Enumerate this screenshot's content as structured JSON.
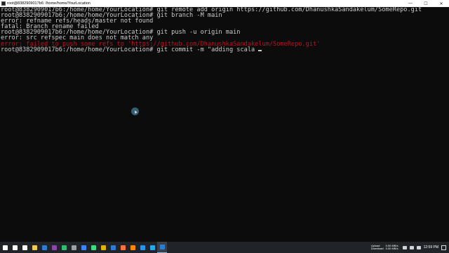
{
  "window": {
    "title": "root@8382909017b6: /home/home/YourLocation",
    "minimize_glyph": "—",
    "maximize_glyph": "☐",
    "close_glyph": "✕"
  },
  "terminal": {
    "lines": [
      {
        "text": "root@8382909017b6:/home/home/YourLocation# git remote add origin https://github.com/DhanushkaSandakelum/SomeRepo.git",
        "type": "normal"
      },
      {
        "text": "root@8382909017b6:/home/home/YourLocation# git branch -M main",
        "type": "normal"
      },
      {
        "text": "error: refname refs/heads/master not found",
        "type": "normal"
      },
      {
        "text": "fatal: Branch rename failed",
        "type": "normal"
      },
      {
        "text": "root@8382909017b6:/home/home/YourLocation# git push -u origin main",
        "type": "normal"
      },
      {
        "text": "error: src refspec main does not match any",
        "type": "normal"
      },
      {
        "text": "error: failed to push some refs to 'https://github.com/DhanushkaSandakelum/SomeRepo.git'",
        "type": "error"
      },
      {
        "text": "root@8382909017b6:/home/home/YourLocation# git commit -m \"adding scala ",
        "type": "normal"
      }
    ],
    "foreground": "#cccccc",
    "error_color": "#c50f1f",
    "background": "#0c0c0c"
  },
  "taskbar": {
    "icons": [
      {
        "name": "windows-start-icon",
        "color": "#ffffff"
      },
      {
        "name": "search-icon",
        "color": "#ffffff"
      },
      {
        "name": "task-view-icon",
        "color": "#ffffff"
      },
      {
        "name": "file-explorer-icon",
        "color": "#f2c94c"
      },
      {
        "name": "mail-icon",
        "color": "#2b7cd3"
      },
      {
        "name": "visual-studio-icon",
        "color": "#8e44ad"
      },
      {
        "name": "edge-icon",
        "color": "#2fbf71"
      },
      {
        "name": "settings-icon",
        "color": "#9aa0a6"
      },
      {
        "name": "store-icon",
        "color": "#3a86ff"
      },
      {
        "name": "android-studio-icon",
        "color": "#3ddc84"
      },
      {
        "name": "chrome-icon",
        "color": "#e0b400"
      },
      {
        "name": "photos-icon",
        "color": "#2b7cd3"
      },
      {
        "name": "firefox-icon",
        "color": "#ff7139"
      },
      {
        "name": "vlc-icon",
        "color": "#ff8800"
      },
      {
        "name": "docker-icon",
        "color": "#2496ed"
      },
      {
        "name": "vscode-icon",
        "color": "#23a9f2"
      },
      {
        "name": "terminal-icon",
        "color": "#2b7cd3",
        "active": true
      }
    ],
    "tray": {
      "net_label_1": "Upload",
      "net_label_2": "Download",
      "upload_speed": "0.00 MB/s",
      "download_speed": "0.00 MB/s",
      "clock": "12:59 PM"
    }
  }
}
